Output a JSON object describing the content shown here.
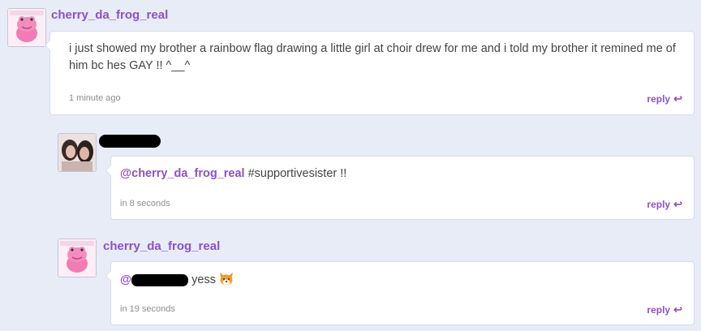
{
  "comments": [
    {
      "username": "cherry_da_frog_real",
      "text": "i just showed my brother a rainbow flag drawing a little girl at choir drew for me and i told my brother it remined me of him bc hes GAY !! ^__^",
      "time": "1 minute ago",
      "reply_label": "reply",
      "avatar_icon": "pink-frog-plush-avatar"
    },
    {
      "username_redacted": true,
      "mention": "@cherry_da_frog_real",
      "text": "#supportivesister !!",
      "time": "in 8 seconds",
      "reply_label": "reply",
      "avatar_icon": "photo-avatar"
    },
    {
      "username": "cherry_da_frog_real",
      "mention": "@",
      "mention_redacted": true,
      "text": "yess",
      "emoji_icon": "fox-face-emoji",
      "time": "in 19 seconds",
      "reply_label": "reply",
      "avatar_icon": "pink-frog-plush-avatar"
    }
  ],
  "colors": {
    "background": "#e7ecf7",
    "accent": "#8a52c8",
    "bubble": "#ffffff",
    "body_text": "#444444",
    "muted": "#8d8d8d"
  }
}
